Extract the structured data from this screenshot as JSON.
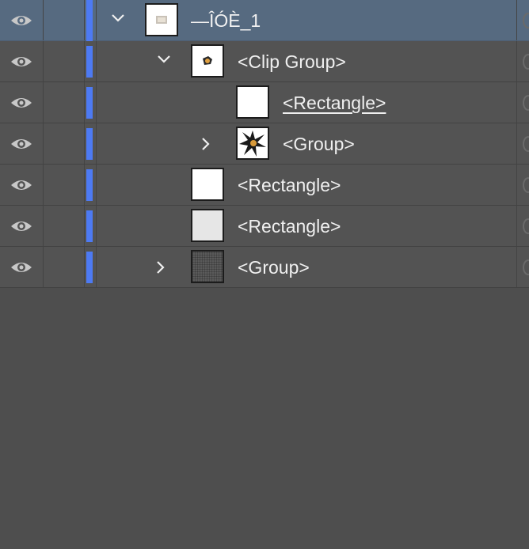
{
  "layers_panel": {
    "accent_color": "#4d7af3",
    "selected_row_color": "#566a80",
    "rows": [
      {
        "name": "—ÎÓÈ_1",
        "icon": "eye-icon",
        "expanded": true,
        "selected": true,
        "thumbnail": "image-thumbnail"
      },
      {
        "name": "<Clip Group>",
        "icon": "eye-icon",
        "expanded": true,
        "selected": false,
        "thumbnail": "artwork-thumbnail"
      },
      {
        "name": "<Rectangle>",
        "icon": "eye-icon",
        "selected": false,
        "underlined": true,
        "thumbnail": "white-rectangle-thumbnail"
      },
      {
        "name": "<Group>",
        "icon": "eye-icon",
        "expanded": false,
        "selected": false,
        "thumbnail": "starburst-thumbnail"
      },
      {
        "name": "<Rectangle>",
        "icon": "eye-icon",
        "selected": false,
        "thumbnail": "white-rectangle-thumbnail"
      },
      {
        "name": "<Rectangle>",
        "icon": "eye-icon",
        "selected": false,
        "thumbnail": "light-gray-rectangle-thumbnail"
      },
      {
        "name": "<Group>",
        "icon": "eye-icon",
        "expanded": false,
        "selected": false,
        "thumbnail": "pattern-thumbnail"
      }
    ]
  }
}
